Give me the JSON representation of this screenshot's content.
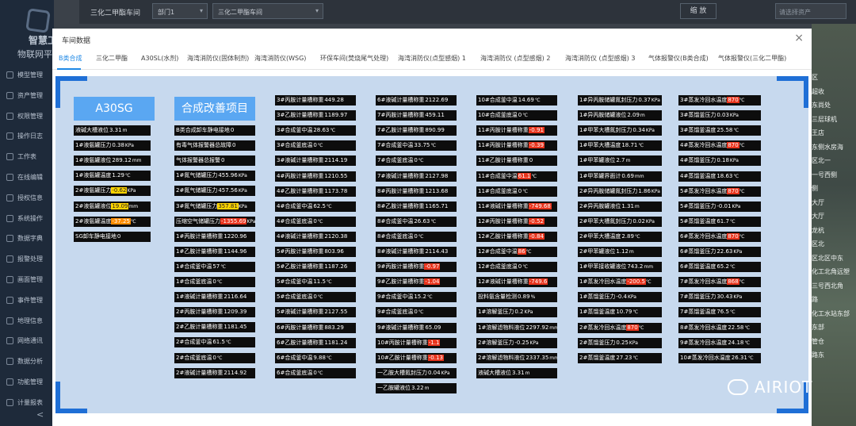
{
  "sidebar": {
    "brand_line1": "智慧工",
    "brand_line2": "物联网平",
    "items": [
      {
        "label": "模型管理",
        "icon": "cube-icon"
      },
      {
        "label": "资产管理",
        "icon": "asset-icon"
      },
      {
        "label": "权限管理",
        "icon": "lock-icon"
      },
      {
        "label": "操作日志",
        "icon": "log-icon"
      },
      {
        "label": "工作表",
        "icon": "table-icon"
      },
      {
        "label": "在线编辑",
        "icon": "edit-icon"
      },
      {
        "label": "授权信息",
        "icon": "key-icon"
      },
      {
        "label": "系统操作",
        "icon": "gear-icon"
      },
      {
        "label": "数据字典",
        "icon": "book-icon"
      },
      {
        "label": "报警处理",
        "icon": "bell-icon"
      },
      {
        "label": "画面管理",
        "icon": "screen-icon"
      },
      {
        "label": "事件管理",
        "icon": "event-icon"
      },
      {
        "label": "地理信息",
        "icon": "map-icon"
      },
      {
        "label": "网络通讯",
        "icon": "network-icon"
      },
      {
        "label": "数据分析",
        "icon": "chart-icon"
      },
      {
        "label": "功能管理",
        "icon": "function-icon"
      },
      {
        "label": "计量报表",
        "icon": "report-icon"
      }
    ],
    "collapse": "<"
  },
  "topbar": {
    "title": "三化二甲酯车间",
    "dept": "部门1",
    "workshop": "三化二甲酯车间",
    "zoom": "缩 放",
    "search_placeholder": "请选择资产"
  },
  "map_labels": [
    "区",
    "超收",
    "东尚处",
    "三层球机",
    "王店",
    "东侧水房海",
    "区北一",
    "一号西侧",
    "侧",
    "大厅",
    "大厅",
    "龙杭",
    "区北",
    "区北区中东",
    "化工北角远塑",
    "三号西北角",
    "路",
    "化工水站东部",
    "东部",
    "管仓",
    "路东"
  ],
  "modal": {
    "title": "车间数据",
    "close": "×",
    "tabs": [
      "B类合成",
      "三化二甲酯",
      "A30SL(水剂)",
      "海湾消防仪(固体制剂)",
      "海湾消防仪(WSG)",
      "环保车间(焚烧尾气处理)",
      "海湾消防仪(点型感烟) 1",
      "海湾消防仪 (点型感烟) 2",
      "海湾消防仪 (点型感烟) 3",
      "气体报警仪(B类合成)",
      "气体报警仪(三化二甲酯)"
    ],
    "active_tab": 0,
    "headers": [
      "A30SG",
      "合成改善项目"
    ],
    "columns": [
      [
        [
          "液碱大槽液位",
          "3.31",
          "m",
          ""
        ],
        [
          "1#液氨罐压力",
          "0.38",
          "KPa",
          ""
        ],
        [
          "1#液氨罐液位",
          "289.12",
          "mm",
          ""
        ],
        [
          "1#液氨罐温度",
          "1.29",
          "℃",
          ""
        ],
        [
          "2#液氨罐压力",
          "-0.62",
          "KPa",
          "y"
        ],
        [
          "2#液氨罐液位",
          "19.09",
          "mm",
          "y"
        ],
        [
          "2#液氨罐温度",
          "-37.25",
          "℃",
          "o"
        ],
        [
          "SG卸车静电接地",
          "0",
          "",
          ""
        ]
      ],
      [
        [
          "B类合成卸车静电接地",
          "0",
          "",
          ""
        ],
        [
          "有毒气体报警器总故障",
          "0",
          "",
          ""
        ],
        [
          "气体报警器总报警",
          "0",
          "",
          ""
        ],
        [
          "1#氮气储罐压力",
          "455.96",
          "KPa",
          ""
        ],
        [
          "2#氮气储罐压力",
          "457.56",
          "KPa",
          ""
        ],
        [
          "3#氮气储罐压力",
          "357.81",
          "KPa",
          "y"
        ],
        [
          "压缩空气储罐压力",
          "-1355.69",
          "KPa",
          "r"
        ],
        [
          "1#丙胺计量槽称重",
          "1220.96",
          "",
          ""
        ],
        [
          "1#乙胺计量槽称重",
          "1144.96",
          "",
          ""
        ],
        [
          "1#合成釜中温",
          "57",
          "℃",
          ""
        ],
        [
          "1#合成釜底温",
          "0",
          "℃",
          ""
        ],
        [
          "1#液碱计量槽称重",
          "2116.64",
          "",
          ""
        ],
        [
          "2#丙胺计量槽称重",
          "1209.39",
          "",
          ""
        ],
        [
          "2#乙胺计量槽称重",
          "1181.45",
          "",
          ""
        ],
        [
          "2#合成釜中温",
          "61.5",
          "℃",
          ""
        ],
        [
          "2#合成釜底温",
          "0",
          "℃",
          ""
        ],
        [
          "2#液碱计量槽称重",
          "2114.92",
          "",
          ""
        ]
      ],
      [
        [
          "3#丙胺计量槽称重",
          "449.28",
          "",
          ""
        ],
        [
          "3#乙胺计量槽称重",
          "1189.97",
          "",
          ""
        ],
        [
          "3#合成釜中温",
          "28.63",
          "℃",
          ""
        ],
        [
          "3#合成釜底温",
          "0",
          "℃",
          ""
        ],
        [
          "3#液碱计量槽称重",
          "2114.19",
          "",
          ""
        ],
        [
          "4#丙胺计量槽称重",
          "1210.55",
          "",
          ""
        ],
        [
          "4#乙胺计量槽称重",
          "1173.78",
          "",
          ""
        ],
        [
          "4#合成釜中温",
          "62.5",
          "℃",
          ""
        ],
        [
          "4#合成釜底温",
          "0",
          "℃",
          ""
        ],
        [
          "4#液碱计量槽称重",
          "2120.38",
          "",
          ""
        ],
        [
          "5#丙胺计量槽称重",
          "803.96",
          "",
          ""
        ],
        [
          "5#乙胺计量槽称重",
          "1187.26",
          "",
          ""
        ],
        [
          "5#合成釜中温",
          "11.5",
          "℃",
          ""
        ],
        [
          "5#合成釜底温",
          "0",
          "℃",
          ""
        ],
        [
          "5#液碱计量槽称重",
          "2127.55",
          "",
          ""
        ],
        [
          "6#丙胺计量槽称重",
          "883.29",
          "",
          ""
        ],
        [
          "6#乙胺计量槽称重",
          "1181.24",
          "",
          ""
        ],
        [
          "6#合成釜中温",
          "9.88",
          "℃",
          ""
        ],
        [
          "6#合成釜底温",
          "0",
          "℃",
          ""
        ]
      ],
      [
        [
          "6#液碱计量槽称重",
          "2122.69",
          "",
          ""
        ],
        [
          "7#丙胺计量槽称重",
          "459.11",
          "",
          ""
        ],
        [
          "7#乙胺计量槽称重",
          "890.99",
          "",
          ""
        ],
        [
          "7#合成釜中温",
          "33.75",
          "℃",
          ""
        ],
        [
          "7#合成釜底温",
          "0",
          "℃",
          ""
        ],
        [
          "7#液碱计量槽称重",
          "2127.98",
          "",
          ""
        ],
        [
          "8#丙胺计量槽称重",
          "1213.68",
          "",
          ""
        ],
        [
          "8#乙胺计量槽称重",
          "1165.71",
          "",
          ""
        ],
        [
          "8#合成釜中温",
          "26.63",
          "℃",
          ""
        ],
        [
          "8#合成釜底温",
          "0",
          "℃",
          ""
        ],
        [
          "8#液碱计量槽称重",
          "2114.43",
          "",
          ""
        ],
        [
          "9#丙胺计量槽称重",
          "-0.97",
          "",
          "r"
        ],
        [
          "9#乙胺计量槽称重",
          "-1.04",
          "",
          "r"
        ],
        [
          "9#合成釜中温",
          "15.2",
          "℃",
          ""
        ],
        [
          "9#合成釜底温",
          "0",
          "℃",
          ""
        ],
        [
          "9#液碱计量槽称重",
          "65.09",
          "",
          ""
        ],
        [
          "10#丙胺计量槽称重",
          "-1.1",
          "",
          "r"
        ],
        [
          "10#乙胺计量槽称重",
          "-0.13",
          "",
          "r"
        ],
        [
          "一乙胺大槽氮封压力",
          "0.04",
          "KPa",
          ""
        ],
        [
          "一乙胺罐液位",
          "3.22",
          "m",
          ""
        ]
      ],
      [
        [
          "10#合成釜中温",
          "14.69",
          "℃",
          ""
        ],
        [
          "10#合成釜底温",
          "0",
          "℃",
          ""
        ],
        [
          "11#丙胺计量槽称重",
          "-0.91",
          "",
          "r"
        ],
        [
          "11#丙胺计量槽称重",
          "-0.39",
          "",
          "r"
        ],
        [
          "11#乙胺计量槽称重",
          "0",
          "",
          ""
        ],
        [
          "11#合成釜中温",
          "61.1",
          "℃",
          "r"
        ],
        [
          "11#合成釜底温",
          "0",
          "℃",
          ""
        ],
        [
          "11#液碱计量槽称重",
          "-749.68",
          "",
          "r"
        ],
        [
          "12#丙胺计量槽称重",
          "-0.52",
          "",
          "r"
        ],
        [
          "12#乙胺计量槽称重",
          "-0.84",
          "",
          "r"
        ],
        [
          "12#合成釜中温",
          "86",
          "℃",
          "r"
        ],
        [
          "12#合成釜底温",
          "0",
          "℃",
          ""
        ],
        [
          "12#液碱计量槽称重",
          "-749.6",
          "",
          "r"
        ],
        [
          "投料氨含量检测",
          "0.89",
          "%",
          ""
        ],
        [
          "1#溶解釜压力",
          "0.2",
          "KPa",
          ""
        ],
        [
          "1#溶解滤物料液位",
          "2297.92",
          "mm",
          ""
        ],
        [
          "2#溶解釜压力",
          "-0.25",
          "KPa",
          ""
        ],
        [
          "2#溶解滤物料液位",
          "2337.35",
          "mm",
          ""
        ],
        [
          "液碱大槽液位",
          "3.31",
          "m",
          ""
        ]
      ],
      [
        [
          "1#异丙胺储罐氮封压力",
          "0.37",
          "KPa",
          ""
        ],
        [
          "1#异丙胺储罐液位",
          "2.09",
          "m",
          ""
        ],
        [
          "1#甲苯大槽氮封压力",
          "0.34",
          "KPa",
          ""
        ],
        [
          "1#甲苯大槽温度",
          "18.71",
          "℃",
          ""
        ],
        [
          "1#甲苯罐液位",
          "2.7",
          "m",
          ""
        ],
        [
          "1#甲苯罐界面计",
          "0.69",
          "mm",
          ""
        ],
        [
          "2#异丙胺储罐氮封压力",
          "1.86",
          "KPa",
          ""
        ],
        [
          "2#异丙胺罐液位",
          "1.31",
          "m",
          ""
        ],
        [
          "2#甲苯大槽氮封压力",
          "0.02",
          "KPa",
          ""
        ],
        [
          "2#甲苯大槽温度",
          "2.89",
          "℃",
          ""
        ],
        [
          "2#甲苯罐液位",
          "1.12",
          "m",
          ""
        ],
        [
          "1#甲苯接收罐液位",
          "743.2",
          "mm",
          ""
        ],
        [
          "1#蒸发冷回水温度",
          "-200.5",
          "℃",
          "r"
        ],
        [
          "1#蒸馏釜压力",
          "-0.4",
          "KPa",
          ""
        ],
        [
          "1#蒸馏釜温度",
          "10.79",
          "℃",
          ""
        ],
        [
          "2#蒸发冷回水温度",
          "870",
          "℃",
          "r"
        ],
        [
          "2#蒸馏釜压力",
          "0.25",
          "KPa",
          ""
        ],
        [
          "2#蒸馏釜温度",
          "27.23",
          "℃",
          ""
        ]
      ],
      [
        [
          "3#蒸发冷回水温度",
          "870",
          "℃",
          "r"
        ],
        [
          "3#蒸馏釜压力",
          "0.03",
          "KPa",
          ""
        ],
        [
          "3#蒸馏釜温度",
          "25.58",
          "℃",
          ""
        ],
        [
          "4#蒸发冷回水温度",
          "870",
          "℃",
          "r"
        ],
        [
          "4#蒸馏釜压力",
          "0.18",
          "KPa",
          ""
        ],
        [
          "4#蒸馏釜温度",
          "18.63",
          "℃",
          ""
        ],
        [
          "5#蒸发冷回水温度",
          "870",
          "℃",
          "r"
        ],
        [
          "5#蒸馏釜压力",
          "-0.01",
          "KPa",
          ""
        ],
        [
          "5#蒸馏釜温度",
          "61.7",
          "℃",
          ""
        ],
        [
          "6#蒸发冷回水温度",
          "870",
          "℃",
          "r"
        ],
        [
          "6#蒸馏釜压力",
          "22.63",
          "KPa",
          ""
        ],
        [
          "6#蒸馏釜温度",
          "65.2",
          "℃",
          ""
        ],
        [
          "7#蒸发冷回水温度",
          "868",
          "℃",
          "r"
        ],
        [
          "7#蒸馏釜压力",
          "30.43",
          "KPa",
          ""
        ],
        [
          "7#蒸馏釜温度",
          "76.5",
          "℃",
          ""
        ],
        [
          "8#蒸发冷回水温度",
          "22.58",
          "℃",
          ""
        ],
        [
          "9#蒸发冷回水温度",
          "24.18",
          "℃",
          ""
        ],
        [
          "10#蒸发冷回水温度",
          "26.31",
          "℃",
          ""
        ]
      ]
    ]
  },
  "watermark": "AIRIOT",
  "colors": {
    "highlight_yellow": "#ffd400",
    "highlight_orange": "#ff8c00",
    "highlight_red": "#e8331c",
    "accent": "#1e88e5",
    "header_box": "#5aa7f2"
  }
}
